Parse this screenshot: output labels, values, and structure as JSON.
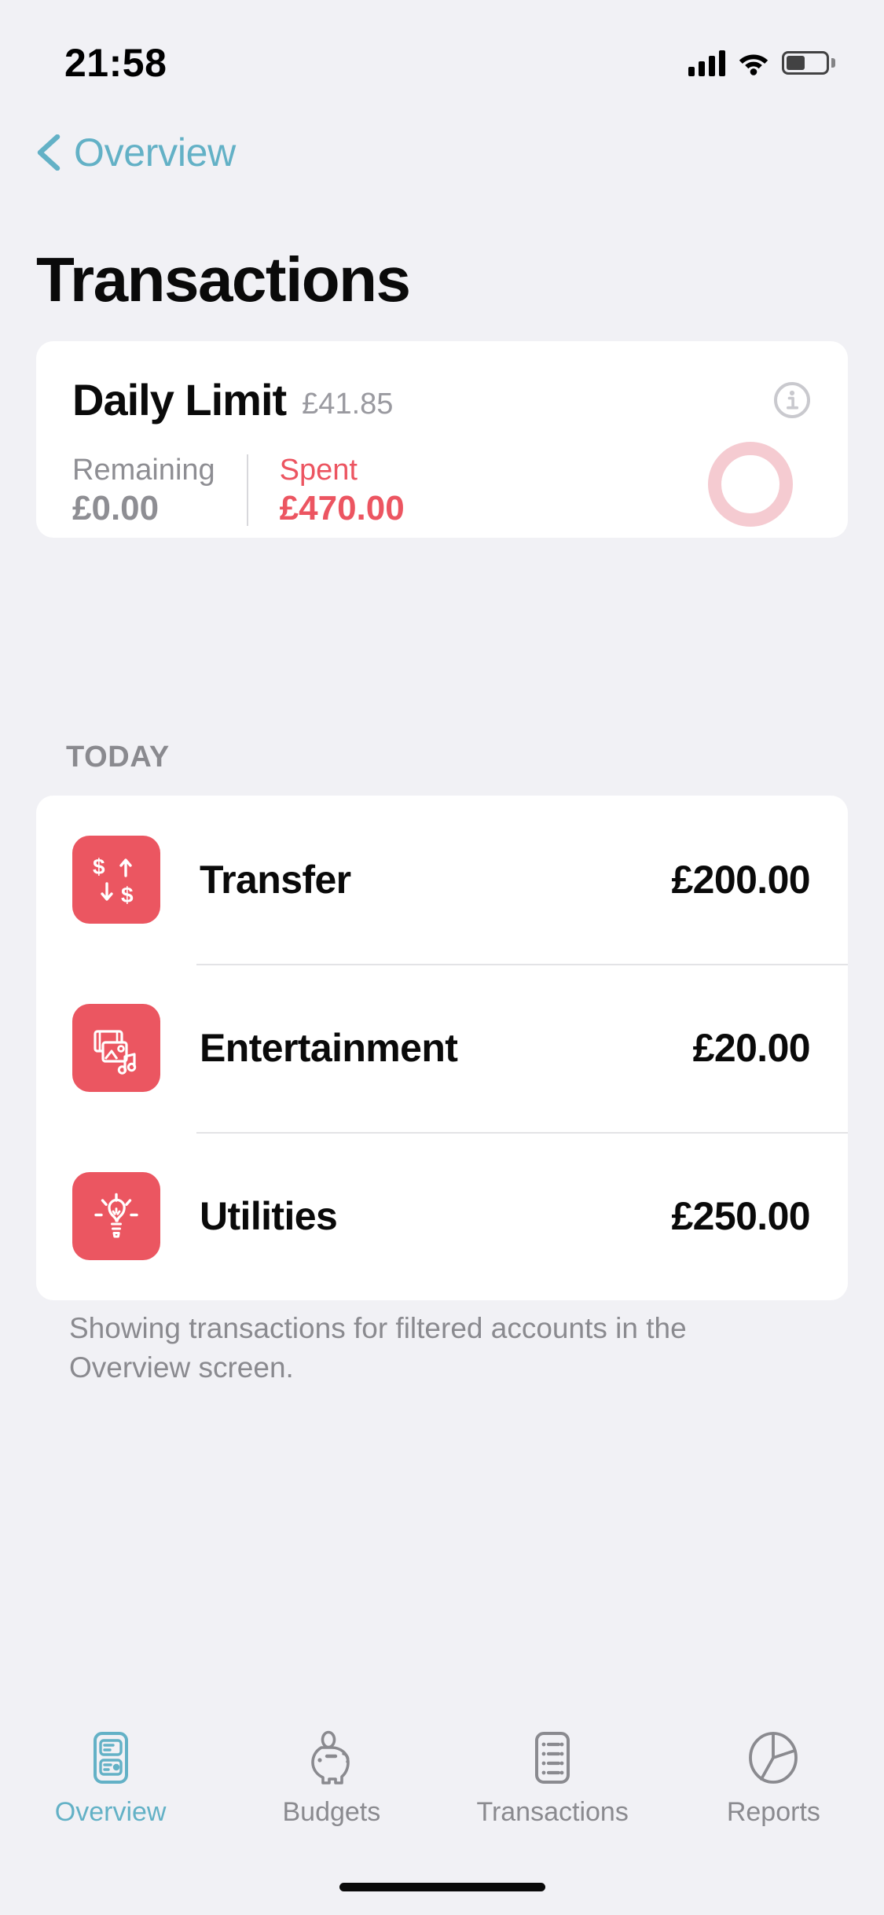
{
  "status_bar": {
    "time": "21:58",
    "signal_icon": "cellular-signal-icon",
    "wifi_icon": "wifi-icon",
    "battery_icon": "battery-icon"
  },
  "nav": {
    "back_label": "Overview",
    "back_icon": "chevron-left-icon",
    "accent_color": "#63B1C6"
  },
  "header": {
    "title": "Transactions"
  },
  "daily_limit": {
    "title": "Daily Limit",
    "amount": "£41.85",
    "info_icon": "info-circle-icon",
    "remaining_label": "Remaining",
    "remaining_value": "£0.00",
    "spent_label": "Spent",
    "spent_value": "£470.00",
    "spent_color": "#EC5561",
    "ring_color": "#F5CBD1",
    "ring_progress_percent": 0
  },
  "section": {
    "today_label": "TODAY"
  },
  "transactions": [
    {
      "icon": "transfer-icon",
      "name": "Transfer",
      "amount": "£200.00"
    },
    {
      "icon": "entertainment-icon",
      "name": "Entertainment",
      "amount": "£20.00"
    },
    {
      "icon": "utilities-icon",
      "name": "Utilities",
      "amount": "£250.00"
    }
  ],
  "footnote": {
    "text": "Showing transactions for filtered accounts in the Overview screen."
  },
  "tabbar": {
    "items": [
      {
        "label": "Overview",
        "icon": "overview-icon",
        "active": true
      },
      {
        "label": "Budgets",
        "icon": "piggy-bank-icon",
        "active": false
      },
      {
        "label": "Transactions",
        "icon": "transactions-list-icon",
        "active": false
      },
      {
        "label": "Reports",
        "icon": "pie-chart-icon",
        "active": false
      }
    ],
    "active_color": "#63B1C6",
    "inactive_color": "#8A8A8F"
  }
}
